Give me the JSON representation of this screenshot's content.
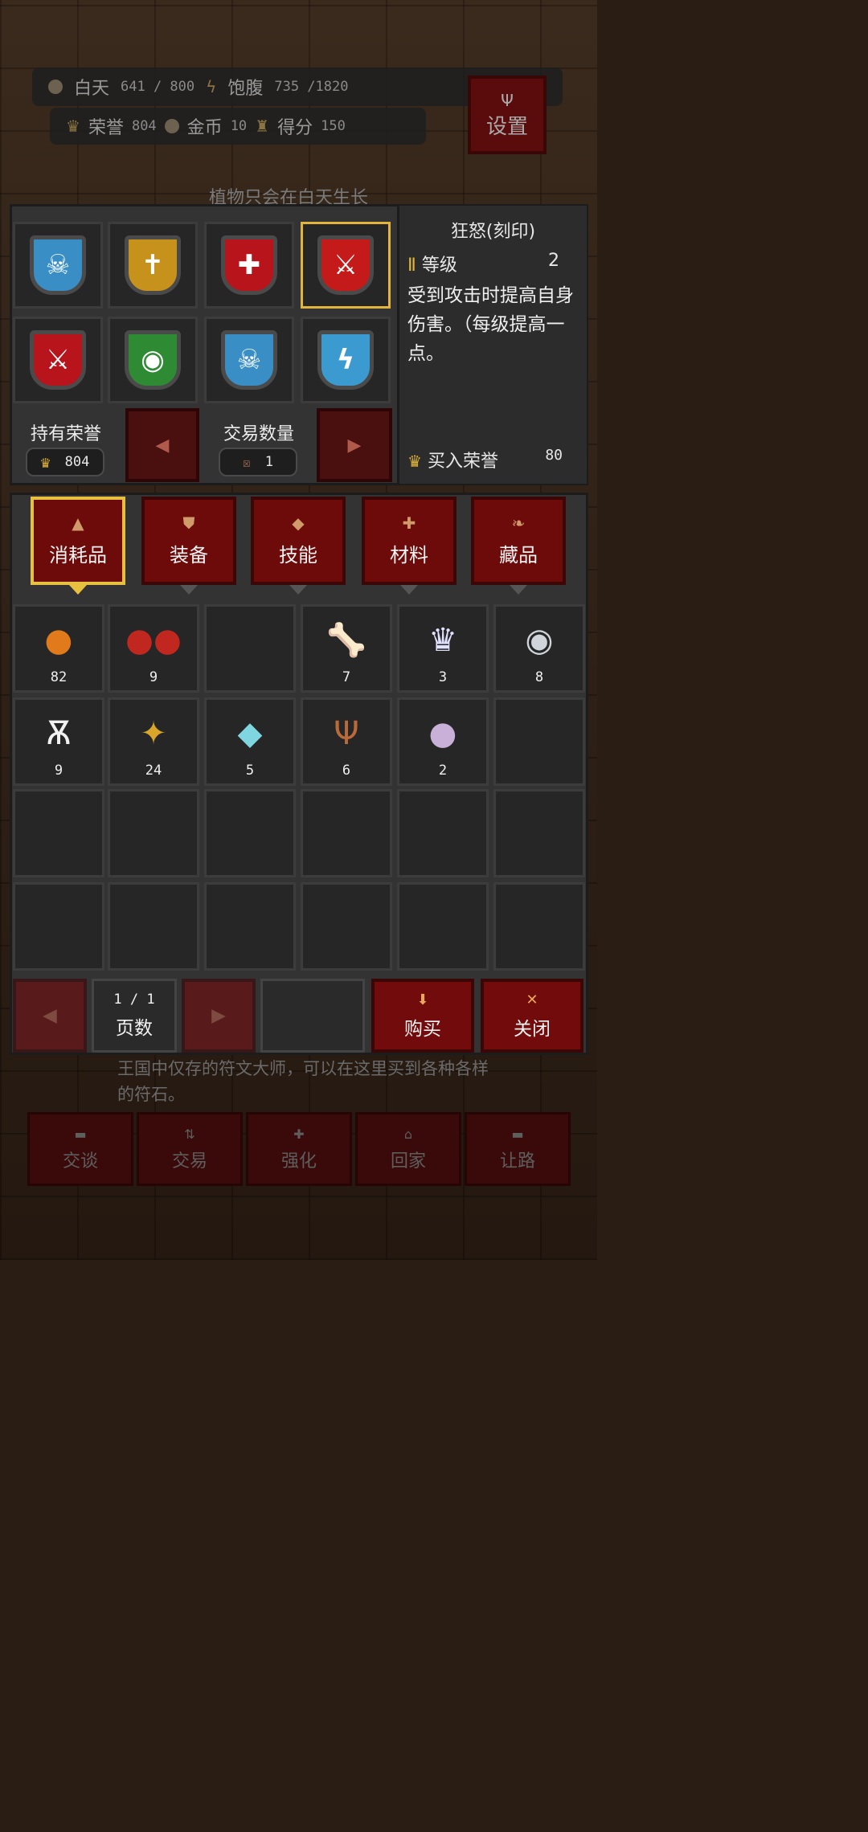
{
  "status": {
    "day_label": "白天",
    "day_value": "641 / 800",
    "satiety_label": "饱腹",
    "satiety_value": "735 /1820",
    "honor_label": "荣誉",
    "honor_value": "804",
    "gold_label": "金币",
    "gold_value": "10",
    "score_label": "得分",
    "score_value": "150",
    "settings_label": "设置",
    "hint": "植物只会在白天生长"
  },
  "rune_panel": {
    "runes": [
      {
        "icon": "blue-ghost-rune-icon",
        "color": "#3a8ec6"
      },
      {
        "icon": "gold-sword-rune-icon",
        "color": "#c7921b"
      },
      {
        "icon": "red-shield-rune-icon",
        "color": "#b8141c"
      },
      {
        "icon": "red-blade-rune-icon",
        "color": "#c51a1a"
      },
      {
        "icon": "red-dagger-rune-icon",
        "color": "#b8141c"
      },
      {
        "icon": "green-eye-rune-icon",
        "color": "#2f8a34"
      },
      {
        "icon": "blue-ghost-rune-icon",
        "color": "#3a8ec6"
      },
      {
        "icon": "blue-lightning-rune-icon",
        "color": "#3b9bd0"
      }
    ],
    "selected_index": 3,
    "held_honor_label": "持有荣誉",
    "held_honor_value": "804",
    "trade_qty_label": "交易数量",
    "trade_qty_value": "1"
  },
  "detail": {
    "title": "狂怒(刻印)",
    "level_label": "等级",
    "level_value": "2",
    "description": "受到攻击时提高自身伤害。（每级提高一点。",
    "buy_label": "买入荣誉",
    "buy_value": "80"
  },
  "tabs": [
    {
      "label": "消耗品",
      "icon": "flask-icon"
    },
    {
      "label": "装备",
      "icon": "shield-icon"
    },
    {
      "label": "技能",
      "icon": "diamond-icon"
    },
    {
      "label": "材料",
      "icon": "cross-icon"
    },
    {
      "label": "藏品",
      "icon": "leaf-icon"
    }
  ],
  "selected_tab": 0,
  "inventory": {
    "row1": [
      {
        "icon": "pumpkin-icon",
        "count": "82"
      },
      {
        "icon": "berries-icon",
        "count": "9"
      },
      {
        "icon": "",
        "count": ""
      },
      {
        "icon": "bone-icon",
        "count": "7"
      },
      {
        "icon": "crown-icon",
        "count": "3"
      },
      {
        "icon": "eyeball-icon",
        "count": "8"
      }
    ],
    "row2": [
      {
        "icon": "angel-wings-icon",
        "count": "9"
      },
      {
        "icon": "gold-emblem-icon",
        "count": "24"
      },
      {
        "icon": "crystal-icon",
        "count": "5"
      },
      {
        "icon": "antler-icon",
        "count": "6"
      },
      {
        "icon": "turnip-icon",
        "count": "2"
      },
      {
        "icon": "",
        "count": ""
      }
    ]
  },
  "pager": {
    "page_value": "1 / 1",
    "page_label": "页数",
    "buy_label": "购买",
    "close_label": "关闭"
  },
  "npc": {
    "dialog": "王国中仅存的符文大师，可以在这里买到各种各样的符石。",
    "actions": [
      "交谈",
      "交易",
      "强化",
      "回家",
      "让路"
    ]
  },
  "colors": {
    "selected_border": "#e2b53a",
    "button_red": "#720b0b"
  }
}
